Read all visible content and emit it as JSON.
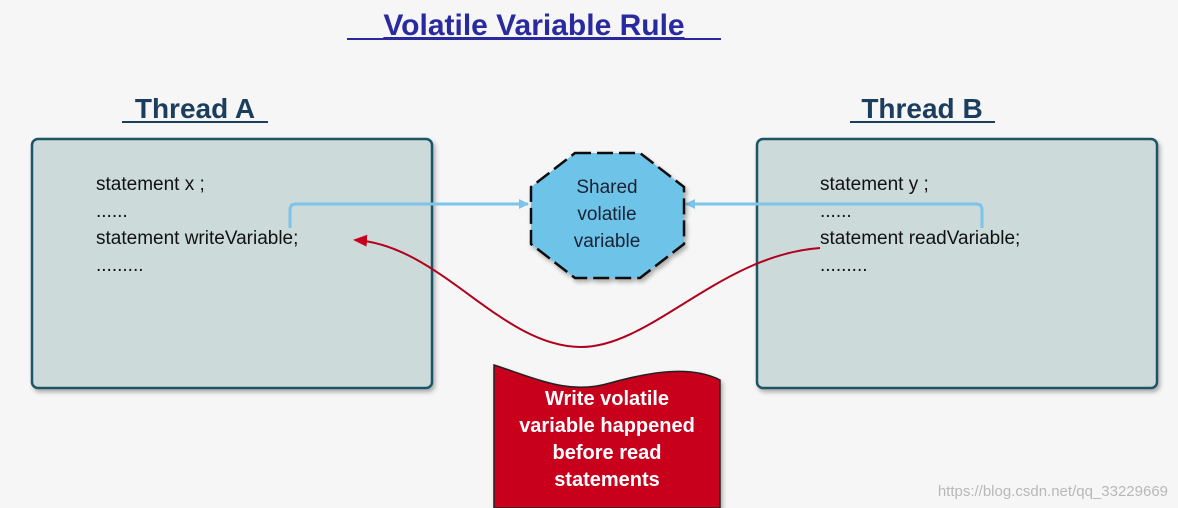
{
  "title": "Volatile Variable Rule",
  "thread_a": {
    "label": "Thread A",
    "lines": [
      "statement x ;",
      "......",
      "statement writeVariable;",
      "........."
    ]
  },
  "thread_b": {
    "label": "Thread B",
    "lines": [
      "statement y ;",
      "......",
      "statement readVariable;",
      "........."
    ]
  },
  "shared": {
    "lines": [
      "Shared",
      "volatile",
      "variable"
    ]
  },
  "banner": {
    "lines": [
      "Write volatile",
      "variable happened",
      "before read",
      "statements"
    ]
  },
  "watermark": "https://blog.csdn.net/qq_33229669",
  "colors": {
    "title": "#2a2aa0",
    "thread_label": "#1b3d5e",
    "box_fill": "#cddada",
    "box_stroke": "#1e5466",
    "shared_fill": "#6ec3e8",
    "banner_fill": "#c8001e",
    "arrow_blue": "#7cc4ea",
    "arrow_red": "#b0001e"
  }
}
